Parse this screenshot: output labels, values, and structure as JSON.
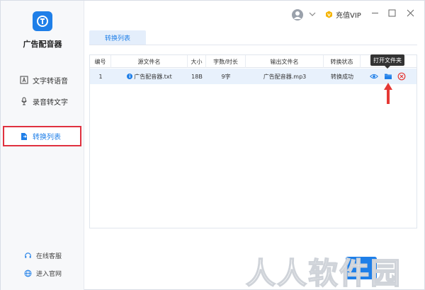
{
  "app": {
    "name": "广告配音器"
  },
  "sidebar": {
    "items": [
      {
        "label": "文字转语音",
        "icon": "text-icon"
      },
      {
        "label": "录音转文字",
        "icon": "microphone-icon"
      },
      {
        "label": "转换列表",
        "icon": "file-convert-icon",
        "active": true
      }
    ],
    "footer": [
      {
        "label": "在线客服",
        "icon": "headset-icon"
      },
      {
        "label": "进入官网",
        "icon": "globe-icon"
      }
    ]
  },
  "topbar": {
    "vip_label": "充值VIP"
  },
  "tabs": [
    {
      "label": "转换列表"
    }
  ],
  "table": {
    "headers": [
      "编号",
      "源文件名",
      "大小",
      "字数/时长",
      "输出文件名",
      "转换状态",
      "操作"
    ],
    "rows": [
      {
        "id": "1",
        "source": "广告配音器.txt",
        "size": "18B",
        "count": "9字",
        "output": "广告配音器.mp3",
        "status": "转换成功"
      }
    ]
  },
  "tooltip": {
    "text": "打开文件夹"
  },
  "watermark": {
    "text": "人人软件园"
  },
  "colors": {
    "accent": "#1f7fe8",
    "highlight_border": "#e0313f",
    "row_selected": "#e8f1fc",
    "delete_red": "#e53935",
    "vip_gold": "#f5b400"
  }
}
